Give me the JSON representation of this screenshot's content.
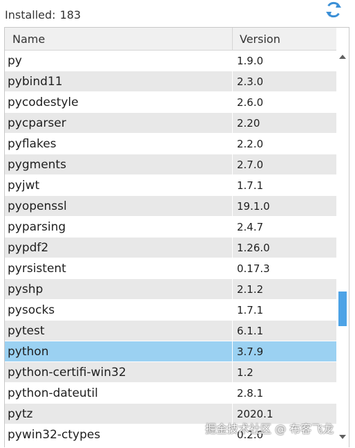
{
  "installed": {
    "label": "Installed:",
    "count": "183"
  },
  "refresh": {
    "icon": "refresh-icon",
    "color": "#3b8fd6"
  },
  "table": {
    "columns": [
      "Name",
      "Version"
    ],
    "rows": [
      {
        "name": "py",
        "version": "1.9.0"
      },
      {
        "name": "pybind11",
        "version": "2.3.0"
      },
      {
        "name": "pycodestyle",
        "version": "2.6.0"
      },
      {
        "name": "pycparser",
        "version": "2.20"
      },
      {
        "name": "pyflakes",
        "version": "2.2.0"
      },
      {
        "name": "pygments",
        "version": "2.7.0"
      },
      {
        "name": "pyjwt",
        "version": "1.7.1"
      },
      {
        "name": "pyopenssl",
        "version": "19.1.0"
      },
      {
        "name": "pyparsing",
        "version": "2.4.7"
      },
      {
        "name": "pypdf2",
        "version": "1.26.0"
      },
      {
        "name": "pyrsistent",
        "version": "0.17.3"
      },
      {
        "name": "pyshp",
        "version": "2.1.2"
      },
      {
        "name": "pysocks",
        "version": "1.7.1"
      },
      {
        "name": "pytest",
        "version": "6.1.1"
      },
      {
        "name": "python",
        "version": "3.7.9"
      },
      {
        "name": "python-certifi-win32",
        "version": "1.2"
      },
      {
        "name": "python-dateutil",
        "version": "2.8.1"
      },
      {
        "name": "pytz",
        "version": "2020.1"
      },
      {
        "name": "pywin32-ctypes",
        "version": "0.2.0"
      }
    ],
    "selected_row": "python",
    "selection_color": "#9bd1f2"
  },
  "scrollbar": {
    "thumb_color": "#4da3e6",
    "up_icon": "scroll-up-arrow-icon",
    "down_icon": "scroll-down-arrow-icon"
  },
  "watermark": "掘金技术社区 @ 布客飞龙"
}
